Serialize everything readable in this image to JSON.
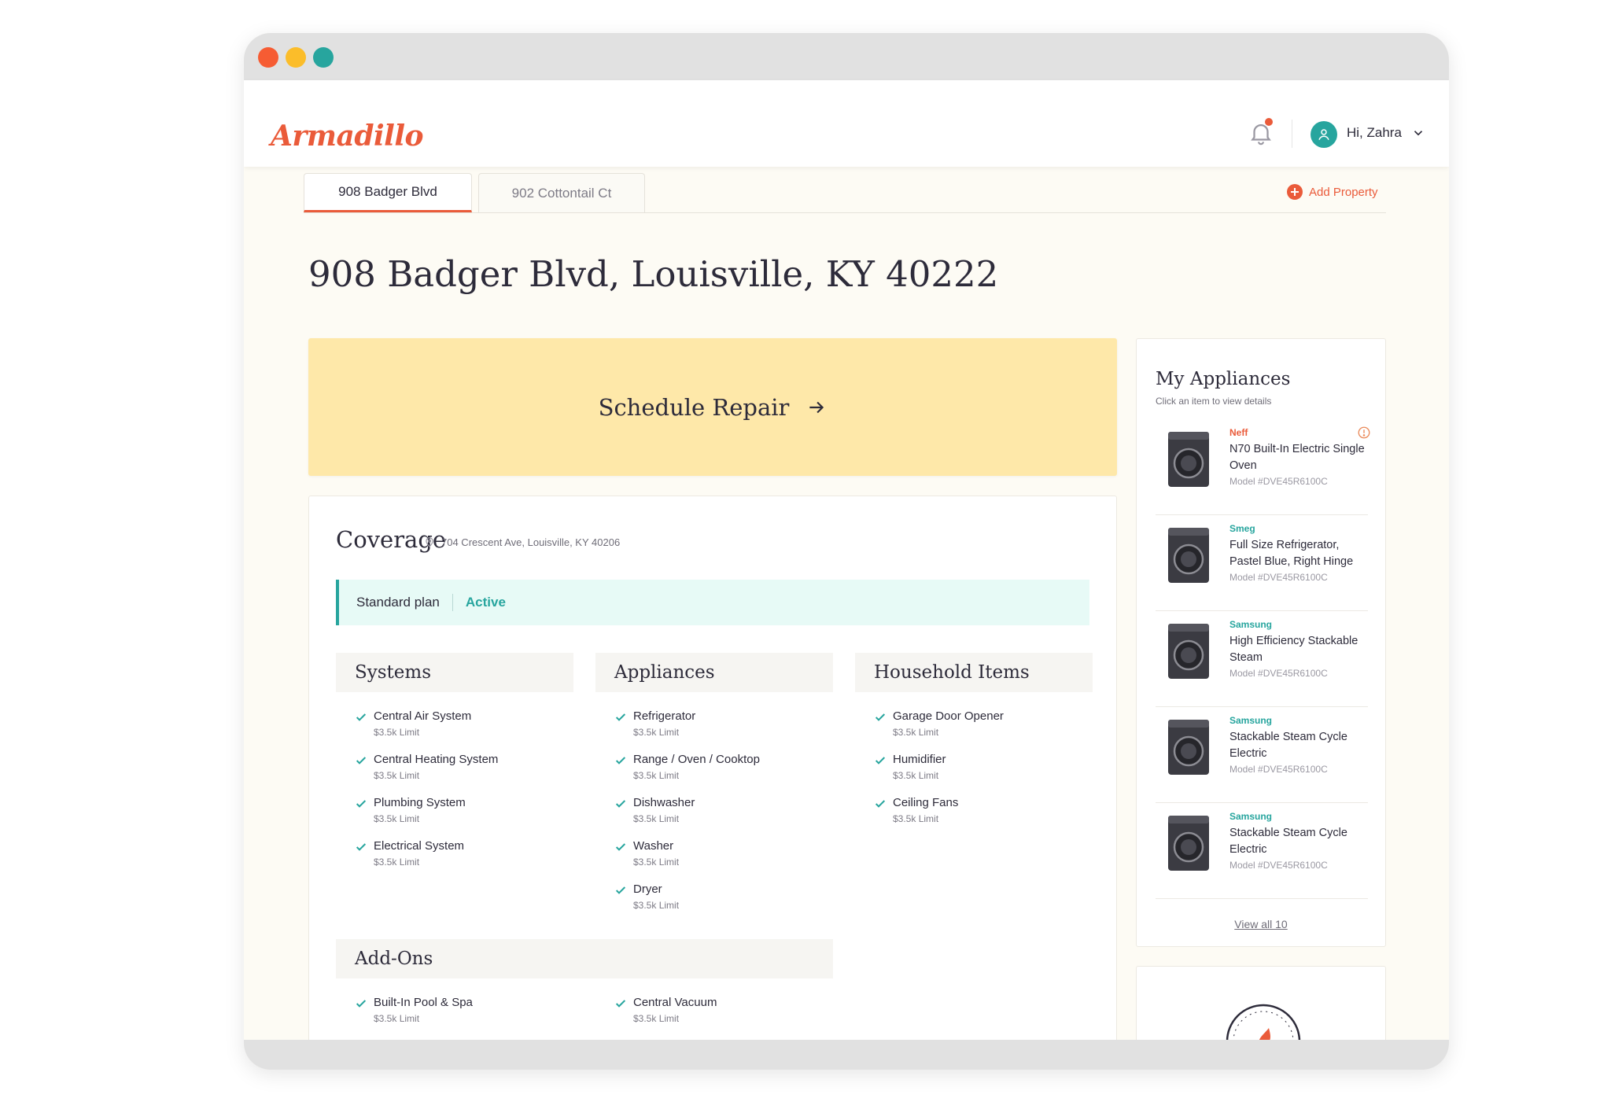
{
  "app": {
    "brand": "Armadillo",
    "greeting": "Hi, Zahra"
  },
  "tabs": [
    {
      "label": "908 Badger Blvd",
      "active": true
    },
    {
      "label": "902 Cottontail Ct",
      "active": false
    }
  ],
  "add_property_label": "Add Property",
  "page_title": "908 Badger Blvd, Louisville, KY 40222",
  "repair": {
    "label": "Schedule Repair"
  },
  "coverage": {
    "title": "Coverage",
    "location": "704 Crescent Ave, Louisville, KY 40206",
    "plan": "Standard plan",
    "status": "Active",
    "groups": [
      {
        "title": "Systems",
        "items": [
          {
            "name": "Central Air System",
            "limit": "$3.5k Limit"
          },
          {
            "name": "Central Heating System",
            "limit": "$3.5k Limit"
          },
          {
            "name": "Plumbing System",
            "limit": "$3.5k Limit"
          },
          {
            "name": "Electrical System",
            "limit": "$3.5k Limit"
          }
        ]
      },
      {
        "title": "Appliances",
        "items": [
          {
            "name": "Refrigerator",
            "limit": "$3.5k Limit"
          },
          {
            "name": "Range / Oven / Cooktop",
            "limit": "$3.5k Limit"
          },
          {
            "name": "Dishwasher",
            "limit": "$3.5k Limit"
          },
          {
            "name": "Washer",
            "limit": "$3.5k Limit"
          },
          {
            "name": "Dryer",
            "limit": "$3.5k Limit"
          }
        ]
      },
      {
        "title": "Household Items",
        "items": [
          {
            "name": "Garage Door Opener",
            "limit": "$3.5k Limit"
          },
          {
            "name": "Humidifier",
            "limit": "$3.5k Limit"
          },
          {
            "name": "Ceiling Fans",
            "limit": "$3.5k Limit"
          }
        ]
      }
    ],
    "addons": {
      "title": "Add-Ons",
      "items": [
        {
          "name": "Built-In Pool & Spa",
          "limit": "$3.5k Limit"
        },
        {
          "name": "Central Vacuum",
          "limit": "$3.5k Limit"
        }
      ]
    }
  },
  "my_appliances": {
    "title": "My Appliances",
    "subtitle": "Click an item to view details",
    "items": [
      {
        "brand": "Neff",
        "name": "N70 Built-In Electric Single Oven",
        "model": "Model #DVE45R6100C",
        "alert": true
      },
      {
        "brand": "Smeg",
        "name": "Full Size Refrigerator, Pastel Blue, Right Hinge",
        "model": "Model #DVE45R6100C",
        "alert": false
      },
      {
        "brand": "Samsung",
        "name": "High Efficiency Stackable Steam",
        "model": "Model #DVE45R6100C",
        "alert": false
      },
      {
        "brand": "Samsung",
        "name": "Stackable Steam Cycle Electric",
        "model": "Model #DVE45R6100C",
        "alert": false
      },
      {
        "brand": "Samsung",
        "name": "Stackable Steam Cycle Electric",
        "model": "Model #DVE45R6100C",
        "alert": false
      }
    ],
    "view_all": "View all 10"
  },
  "colors": {
    "accent": "#ea5b3a",
    "teal": "#27a59e",
    "repair_bg": "#fee8a9",
    "page_bg": "#fdfbf4"
  },
  "icons": [
    "bell-icon",
    "user-icon",
    "chevron-down-icon",
    "plus-circle-icon",
    "arrow-right-icon",
    "location-pin-icon",
    "check-icon",
    "info-icon",
    "washer-icon",
    "gauge-icon"
  ]
}
